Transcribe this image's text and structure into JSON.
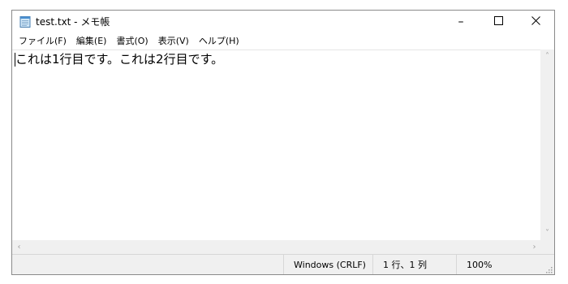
{
  "window": {
    "title": "test.txt - メモ帳",
    "controls": {
      "minimize": "–",
      "maximize": "☐",
      "close": "✕"
    }
  },
  "menubar": {
    "items": [
      {
        "label": "ファイル(F)"
      },
      {
        "label": "編集(E)"
      },
      {
        "label": "書式(O)"
      },
      {
        "label": "表示(V)"
      },
      {
        "label": "ヘルプ(H)"
      }
    ]
  },
  "editor": {
    "content": "これは1行目です。これは2行目です。"
  },
  "scrollbars": {
    "up": "˄",
    "down": "˅",
    "left": "‹",
    "right": "›"
  },
  "statusbar": {
    "encoding": "Windows (CRLF)",
    "position": "1 行、1 列",
    "zoom": "100%"
  },
  "colors": {
    "window_bg": "#ffffff",
    "chrome_bg": "#f0f0f0",
    "border": "#8a8a8a"
  }
}
